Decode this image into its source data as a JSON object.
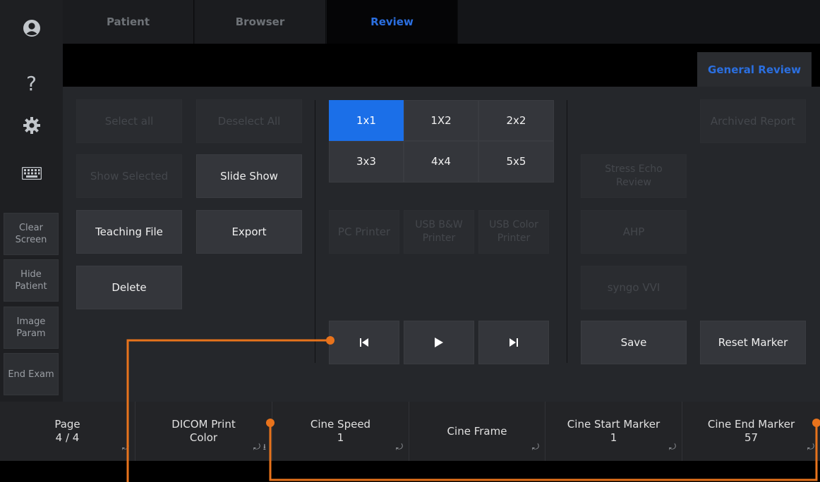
{
  "left_bar": {
    "icons": [
      "user-icon",
      "help-icon",
      "gear-icon",
      "keyboard-icon"
    ],
    "help_glyph": "?",
    "buttons": [
      {
        "label": "Clear\nScreen"
      },
      {
        "label": "Hide\nPatient"
      },
      {
        "label": "Image\nParam"
      },
      {
        "label": "End Exam"
      }
    ]
  },
  "tabs": {
    "patient": "Patient",
    "browser": "Browser",
    "review": "Review",
    "active": "Review"
  },
  "general_review": "General Review",
  "main": {
    "select_all": "Select all",
    "deselect_all": "Deselect All",
    "show_selected": "Show Selected",
    "slide_show": "Slide Show",
    "teaching_file": "Teaching File",
    "export": "Export",
    "delete": "Delete",
    "layouts": [
      "1x1",
      "1X2",
      "2x2",
      "3x3",
      "4x4",
      "5x5"
    ],
    "selected_layout": "1x1",
    "pc_printer": "PC Printer",
    "usb_bw_printer": "USB B&W\nPrinter",
    "usb_color_printer": "USB Color\nPrinter",
    "archived_report": "Archived Report",
    "stress_echo_review": "Stress Echo\nReview",
    "ahp": "AHP",
    "syngo_vvi": "syngo VVI",
    "save": "Save",
    "reset_marker": "Reset Marker",
    "playback_icons": [
      "skip-to-start-icon",
      "play-icon",
      "skip-to-end-icon"
    ]
  },
  "params": {
    "page": {
      "label": "Page",
      "value": "4 / 4"
    },
    "dicom_print": {
      "label": "DICOM Print",
      "value": "Color"
    },
    "cine_speed": {
      "label": "Cine Speed",
      "value": "1"
    },
    "cine_frame": {
      "label": "Cine Frame"
    },
    "cine_start_marker": {
      "label": "Cine Start Marker",
      "value": "1"
    },
    "cine_end_marker": {
      "label": "Cine End Marker",
      "value": "57"
    }
  },
  "colors": {
    "accent_blue": "#2b6fe0",
    "selected_blue": "#1b6fe8",
    "annotation_orange": "#e8731c"
  }
}
